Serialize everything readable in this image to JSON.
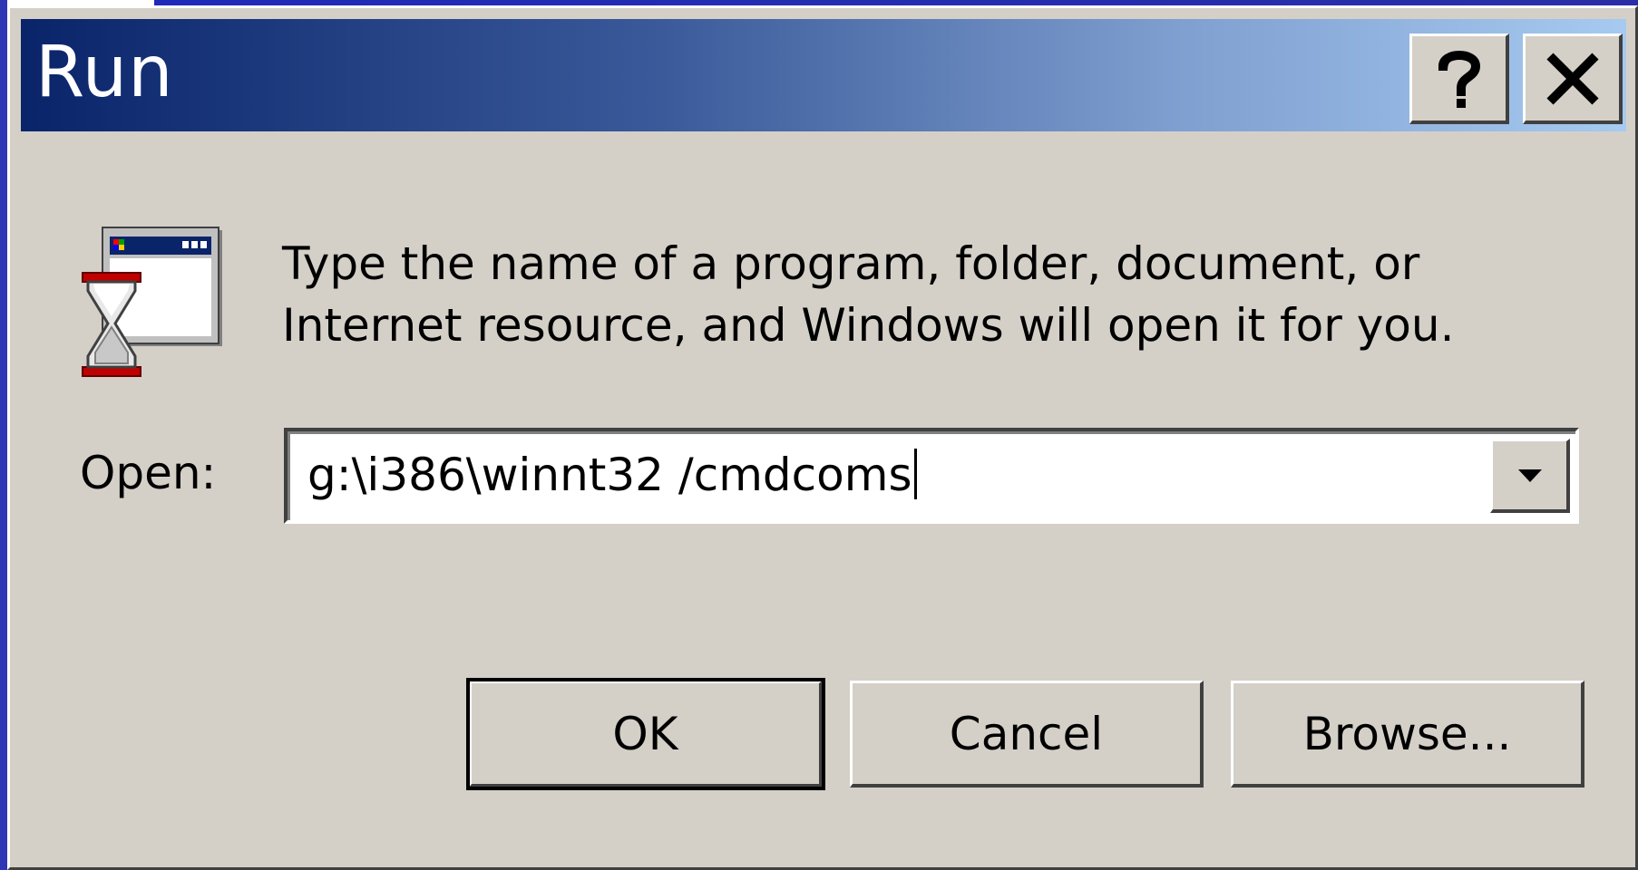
{
  "window": {
    "title": "Run",
    "help_glyph": "?",
    "close_glyph": "X"
  },
  "icons": {
    "app": "run-dialog-window-hourglass-icon",
    "help": "question-mark-icon",
    "close": "close-x-icon",
    "dropdown": "triangle-down-icon"
  },
  "body": {
    "prompt_line1": "Type the name of a program, folder, document, or",
    "prompt_line2": "Internet resource, and Windows will open it for you."
  },
  "open": {
    "label": "Open:",
    "value": "g:\\i386\\winnt32 /cmdcoms"
  },
  "buttons": {
    "ok": "OK",
    "cancel": "Cancel",
    "browse": "Browse..."
  },
  "colors": {
    "face": "#d4d0c8",
    "title_start": "#0a246a",
    "title_end": "#a6caf0",
    "title_text": "#ffffff"
  }
}
